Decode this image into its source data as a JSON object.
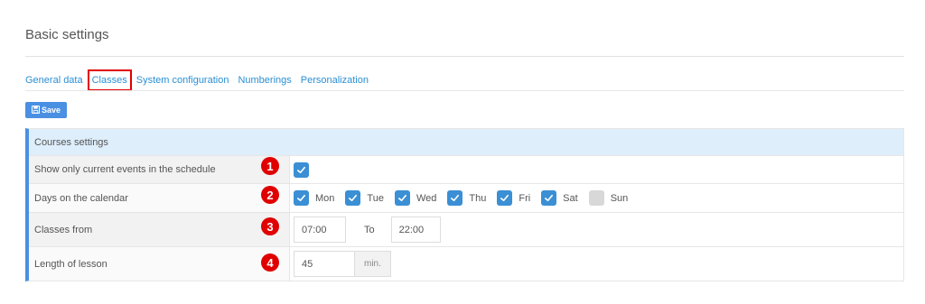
{
  "page": {
    "title": "Basic settings"
  },
  "tabs": [
    {
      "label": "General data",
      "active": false
    },
    {
      "label": "Classes",
      "active": true
    },
    {
      "label": "System configuration",
      "active": false
    },
    {
      "label": "Numberings",
      "active": false
    },
    {
      "label": "Personalization",
      "active": false
    }
  ],
  "toolbar": {
    "save_label": "Save",
    "save_icon": "floppy-disk-icon"
  },
  "panel": {
    "header": "Courses settings",
    "rows": {
      "current_events": {
        "label": "Show only current events in the schedule",
        "marker": "1",
        "checked": true
      },
      "days": {
        "label": "Days on the calendar",
        "marker": "2",
        "items": [
          {
            "label": "Mon",
            "checked": true
          },
          {
            "label": "Tue",
            "checked": true
          },
          {
            "label": "Wed",
            "checked": true
          },
          {
            "label": "Thu",
            "checked": true
          },
          {
            "label": "Fri",
            "checked": true
          },
          {
            "label": "Sat",
            "checked": true
          },
          {
            "label": "Sun",
            "checked": false
          }
        ]
      },
      "classes_from": {
        "label": "Classes from",
        "marker": "3",
        "from": "07:00",
        "to_label": "To",
        "to": "22:00"
      },
      "lesson_length": {
        "label": "Length of lesson",
        "marker": "4",
        "value": "45",
        "unit": "min."
      }
    }
  },
  "colors": {
    "accent": "#3a8fd5",
    "marker": "#e00000",
    "header_bg": "#deeefb",
    "link": "#2a8fd4"
  }
}
